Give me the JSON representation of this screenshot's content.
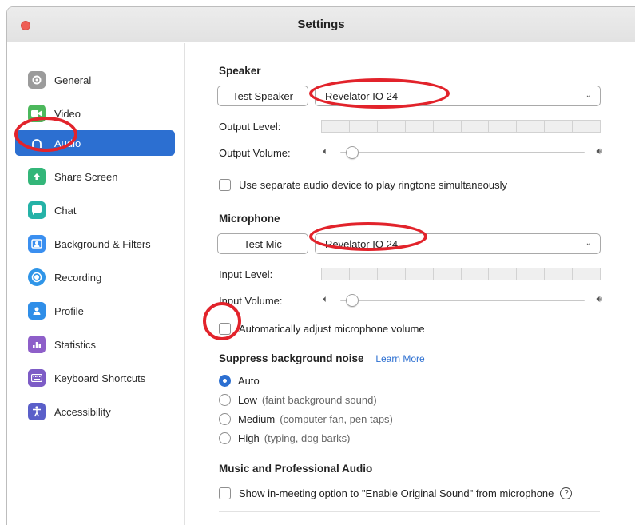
{
  "window": {
    "title": "Settings"
  },
  "sidebar": {
    "items": [
      {
        "label": "General",
        "icon": "gear-icon",
        "color": "#9b9b9b"
      },
      {
        "label": "Video",
        "icon": "video-camera-icon",
        "color": "#4cb85c"
      },
      {
        "label": "Audio",
        "icon": "headphones-icon",
        "color": "#2c6fd1"
      },
      {
        "label": "Share Screen",
        "icon": "share-screen-icon",
        "color": "#33b679"
      },
      {
        "label": "Chat",
        "icon": "chat-bubble-icon",
        "color": "#25b2a7"
      },
      {
        "label": "Background & Filters",
        "icon": "background-icon",
        "color": "#3a8ff0"
      },
      {
        "label": "Recording",
        "icon": "record-icon",
        "color": "#2f95e8"
      },
      {
        "label": "Profile",
        "icon": "profile-icon",
        "color": "#2f8ee8"
      },
      {
        "label": "Statistics",
        "icon": "statistics-icon",
        "color": "#8e5fc9"
      },
      {
        "label": "Keyboard Shortcuts",
        "icon": "keyboard-icon",
        "color": "#7d5cc6"
      },
      {
        "label": "Accessibility",
        "icon": "accessibility-icon",
        "color": "#5a5fc9"
      }
    ],
    "active_index": 2
  },
  "speaker": {
    "heading": "Speaker",
    "test_button": "Test Speaker",
    "device": "Revelator IO 24",
    "output_level_label": "Output Level:",
    "output_volume_label": "Output Volume:",
    "volume_level": 0.03,
    "separate_device_label": "Use separate audio device to play ringtone simultaneously"
  },
  "microphone": {
    "heading": "Microphone",
    "test_button": "Test Mic",
    "device": "Revelator IO 24",
    "input_level_label": "Input Level:",
    "input_volume_label": "Input Volume:",
    "volume_level": 0.03,
    "auto_adjust_label": "Automatically adjust microphone volume"
  },
  "noise": {
    "heading": "Suppress background noise",
    "learn_more": "Learn More",
    "options": [
      {
        "label": "Auto",
        "hint": "",
        "selected": true
      },
      {
        "label": "Low",
        "hint": "(faint background sound)",
        "selected": false
      },
      {
        "label": "Medium",
        "hint": "(computer fan, pen taps)",
        "selected": false
      },
      {
        "label": "High",
        "hint": "(typing, dog barks)",
        "selected": false
      }
    ]
  },
  "music": {
    "heading": "Music and Professional Audio",
    "original_sound_label": "Show in-meeting option to \"Enable Original Sound\" from microphone"
  },
  "colors": {
    "accent": "#2c6fd1",
    "annotation": "#e2232b",
    "close": "#ee5e55"
  }
}
